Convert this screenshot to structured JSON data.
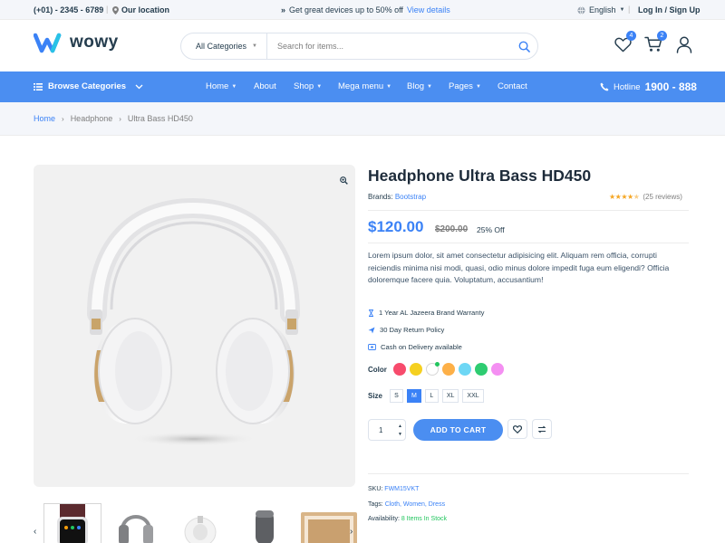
{
  "topbar": {
    "phone": "(+01) - 2345 - 6789",
    "location": "Our location",
    "promo_text": "Get great devices up to 50% off",
    "promo_link": "View details",
    "language": "English",
    "login": "Log In / Sign Up"
  },
  "header": {
    "logo_text": "wowy",
    "search_category": "All Categories",
    "search_placeholder": "Search for items...",
    "wishlist_count": "4",
    "cart_count": "2"
  },
  "nav": {
    "browse": "Browse Categories",
    "items": [
      {
        "label": "Home",
        "dropdown": true
      },
      {
        "label": "About",
        "dropdown": false
      },
      {
        "label": "Shop",
        "dropdown": true
      },
      {
        "label": "Mega menu",
        "dropdown": true
      },
      {
        "label": "Blog",
        "dropdown": true
      },
      {
        "label": "Pages",
        "dropdown": true
      },
      {
        "label": "Contact",
        "dropdown": false
      }
    ],
    "hotline_label": "Hotline",
    "hotline_number": "1900 - 888"
  },
  "breadcrumb": [
    "Home",
    "Headphone",
    "Ultra Bass HD450"
  ],
  "product": {
    "title": "Headphone Ultra Bass HD450",
    "brand_label": "Brands:",
    "brand": "Bootstrap",
    "reviews": "(25 reviews)",
    "rating": 4.5,
    "price": "$120.00",
    "old_price": "$200.00",
    "discount": "25% Off",
    "description": "Lorem ipsum dolor, sit amet consectetur adipisicing elit. Aliquam rem officia, corrupti reiciendis minima nisi modi, quasi, odio minus dolore impedit fuga eum eligendi? Officia doloremque facere quia. Voluptatum, accusantium!",
    "features": [
      {
        "icon": "warranty-icon",
        "text": "1 Year AL Jazeera Brand Warranty"
      },
      {
        "icon": "return-icon",
        "text": "30 Day Return Policy"
      },
      {
        "icon": "cash-icon",
        "text": "Cash on Delivery available"
      }
    ],
    "color_label": "Color",
    "colors": [
      "#f74b6c",
      "#f5d020",
      "#ffffff",
      "#fdb048",
      "#6ed7f5",
      "#2ecc71",
      "#f48ff2"
    ],
    "selected_color_index": 2,
    "size_label": "Size",
    "sizes": [
      "S",
      "M",
      "L",
      "XL",
      "XXL"
    ],
    "selected_size": "M",
    "quantity": "1",
    "add_to_cart": "ADD TO CART",
    "sku_label": "SKU:",
    "sku": "FWM15VKT",
    "tags_label": "Tags:",
    "tags": "Cloth, Women, Dress",
    "availability_label": "Availability:",
    "availability": "8 Items In Stock"
  },
  "thumbnails": [
    "smart-watch",
    "grey-headphone",
    "white-headphone",
    "speaker",
    "tablet"
  ],
  "accent_color": "#4b8ef1"
}
